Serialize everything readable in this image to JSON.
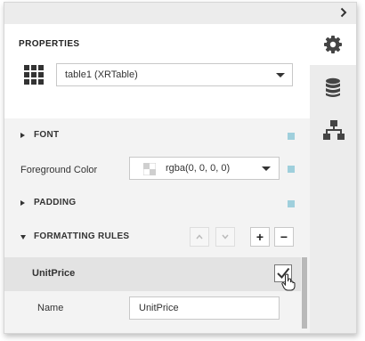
{
  "panel": {
    "title": "PROPERTIES",
    "component": "table1 (XRTable)"
  },
  "side_tabs": [
    {
      "icon": "gear-icon",
      "active": true
    },
    {
      "icon": "database-icon",
      "active": false
    },
    {
      "icon": "hierarchy-icon",
      "active": false
    }
  ],
  "sections": {
    "font": "FONT",
    "padding": "PADDING",
    "formatting_rules": "FORMATTING RULES"
  },
  "foreground_color": {
    "label": "Foreground Color",
    "value": "rgba(0, 0, 0, 0)"
  },
  "formatting_rules": {
    "move_up_symbol": "chevron-up",
    "move_down_symbol": "chevron-down",
    "add_symbol": "+",
    "remove_symbol": "−",
    "rule": {
      "name": "UnitPrice",
      "checked": true,
      "name_label": "Name",
      "name_value": "UnitPrice"
    }
  },
  "colors": {
    "marker": "#9fcfdc",
    "selected_row": "#e3e3e3",
    "panel_bg": "#f3f3f3"
  }
}
